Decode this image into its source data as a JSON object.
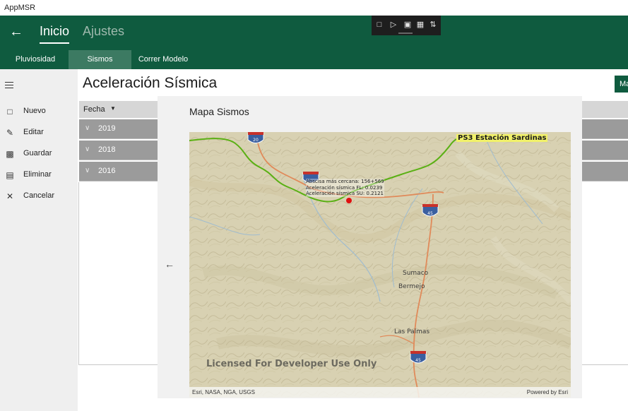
{
  "window": {
    "title": "AppMSR"
  },
  "header": {
    "nav": [
      {
        "label": "Inicio",
        "active": true
      },
      {
        "label": "Ajustes",
        "active": false
      }
    ]
  },
  "tabs": [
    {
      "label": "Pluviosidad",
      "active": false
    },
    {
      "label": "Sismos",
      "active": true
    },
    {
      "label": "Correr Modelo",
      "active": false
    }
  ],
  "commands": [
    {
      "icon": "new-icon",
      "label": "Nuevo"
    },
    {
      "icon": "edit-icon",
      "label": "Editar"
    },
    {
      "icon": "save-icon",
      "label": "Guardar"
    },
    {
      "icon": "delete-icon",
      "label": "Eliminar"
    },
    {
      "icon": "close-icon",
      "label": "Cancelar"
    }
  ],
  "page": {
    "title": "Aceleración Sísmica",
    "map_button_label": "Ma"
  },
  "grid": {
    "column_header": "Fecha",
    "groups": [
      {
        "label": "2019"
      },
      {
        "label": "2018"
      },
      {
        "label": "2016"
      }
    ]
  },
  "dialog": {
    "title": "Mapa Sismos",
    "map": {
      "station_label": "PS3 Estación Sardinas",
      "earthquake_info": [
        "Abscisa más cercana: 156+569",
        "Aceleración sísmica FL: 0.0239",
        "Aceleración sísmica SU: 0.2121"
      ],
      "place_labels": [
        "Sumaco",
        "Bermejo",
        "Las Palmas"
      ],
      "highway_shields": [
        "20",
        "45",
        "45",
        "45"
      ],
      "watermark": "Licensed For Developer Use Only",
      "attribution_left": "Esri, NASA, NGA, USGS",
      "attribution_right": "Powered by Esri"
    }
  },
  "colors": {
    "header_green": "#0f5b3f",
    "active_tab": "#3c7a62",
    "group_row": "#9b9b9b",
    "route_green": "#5ab014",
    "road_orange": "#e08a5a",
    "epicenter_red": "#e01010"
  }
}
